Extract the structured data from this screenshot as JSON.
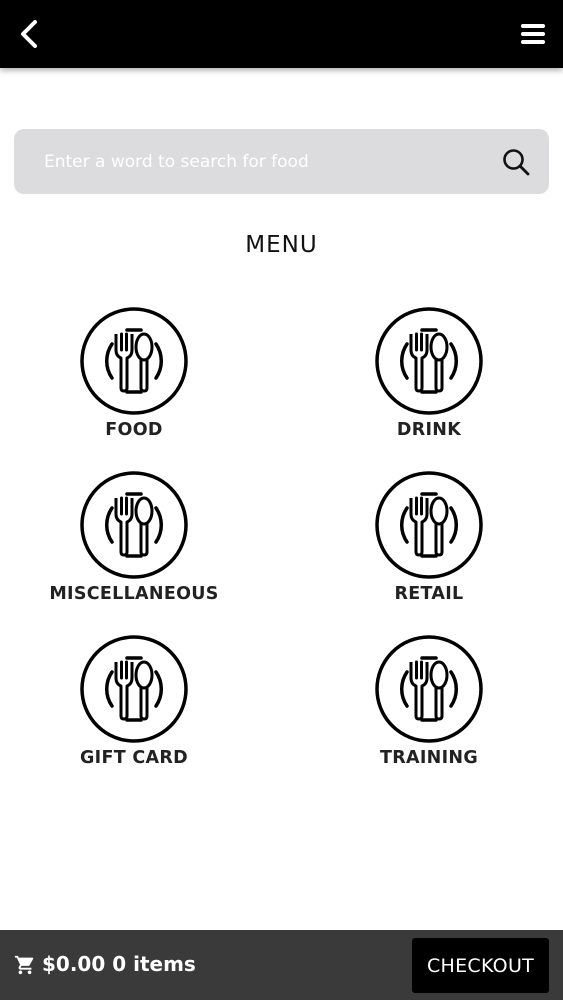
{
  "header": {
    "back_icon": "chevron-left-icon",
    "menu_icon": "hamburger-menu-icon"
  },
  "search": {
    "placeholder": "Enter a word to search for food",
    "value": "",
    "icon": "search-icon"
  },
  "menu": {
    "title": "MENU",
    "categories": [
      {
        "label": "FOOD",
        "icon": "fork-spoon-plate-icon"
      },
      {
        "label": "DRINK",
        "icon": "fork-spoon-plate-icon"
      },
      {
        "label": "MISCELLANEOUS",
        "icon": "fork-spoon-plate-icon"
      },
      {
        "label": "RETAIL",
        "icon": "fork-spoon-plate-icon"
      },
      {
        "label": "GIFT CARD",
        "icon": "fork-spoon-plate-icon"
      },
      {
        "label": "TRAINING",
        "icon": "fork-spoon-plate-icon"
      }
    ]
  },
  "cart": {
    "icon": "cart-icon",
    "total": "$0.00 0 items",
    "checkout_label": "CHECKOUT"
  },
  "colors": {
    "topbar": "#000000",
    "search_bg": "#dcdbdd",
    "bottombar": "#3a3a3a",
    "checkout_bg": "#000000"
  }
}
